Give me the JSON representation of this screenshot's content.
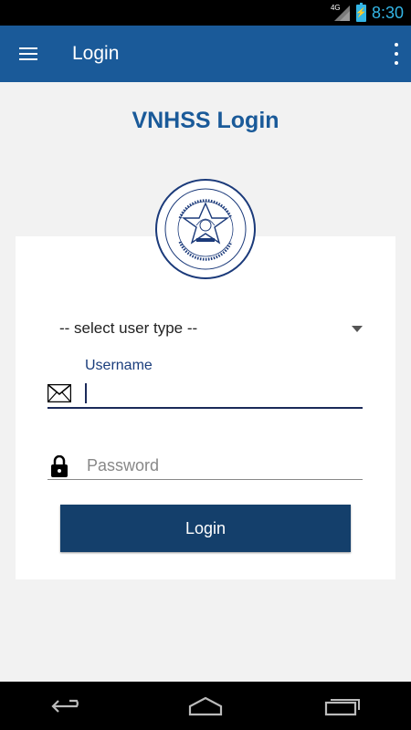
{
  "status_bar": {
    "time": "8:30",
    "network": "4G"
  },
  "app_bar": {
    "title": "Login"
  },
  "page": {
    "heading": "VNHSS Login"
  },
  "form": {
    "user_type_select": "-- select user type --",
    "username_label": "Username",
    "username_value": "",
    "password_placeholder": "Password",
    "login_button": "Login"
  },
  "colors": {
    "primary": "#1a5a99",
    "button": "#143f6b",
    "status_accent": "#33b5e5"
  }
}
